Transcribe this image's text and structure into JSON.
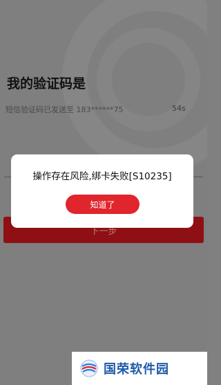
{
  "screen": {
    "title": "我的验证码是",
    "sent_info": "短信验证码已发送至 183******75",
    "countdown": "54s",
    "next_button": "下一步"
  },
  "dialog": {
    "message": "操作存在风险,绑卡失败[S10235]",
    "confirm_label": "知道了"
  },
  "watermark": {
    "text": "国荣软件园"
  },
  "colors": {
    "overlay": "#7f7f7f",
    "primary_red": "#e0252c",
    "dim_red": "#8f1014",
    "watermark_blue": "#1e5aa8"
  }
}
